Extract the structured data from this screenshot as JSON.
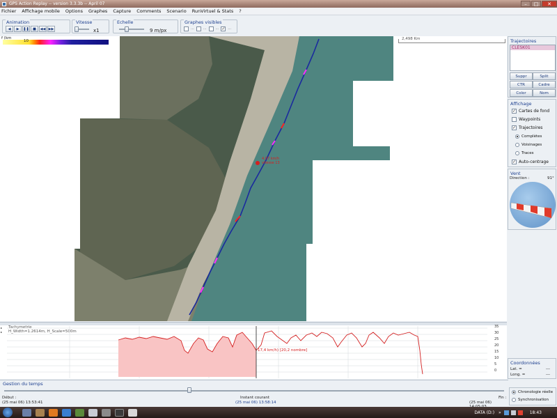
{
  "window": {
    "title": "GPS Action Replay -- version 3.3.3b -- April 07"
  },
  "menu": [
    "Fichier",
    "Affichage mobile",
    "Options",
    "Graphes",
    "Capture",
    "Comments",
    "Scenario",
    "RunVirtuel & Stats",
    "?"
  ],
  "toolbar": {
    "animation_label": "Animation",
    "vitesse_label": "Vitesse",
    "vitesse_value": "x1",
    "echelle_label": "Echelle",
    "echelle_value": "9 m/px",
    "graphes_label": "Graphes visibles",
    "graph_checks": [
      {
        "label": "...",
        "checked": false
      },
      {
        "label": "...",
        "checked": false
      },
      {
        "label": "...",
        "checked": false
      },
      {
        "label": "...",
        "checked": true
      }
    ]
  },
  "map": {
    "speed_scale_unit": "f (km",
    "speed_scale_mark": "10",
    "distance_label": "2,498 Km",
    "track_label_1": "4,07 km/h",
    "track_label_2": "vitesse 13"
  },
  "trajectoires": {
    "title": "Trajectoires",
    "selected_item": "CLESK01",
    "buttons": [
      "Suppr",
      "Split",
      "CTR",
      "Cadre",
      "Color",
      "Nom"
    ]
  },
  "affichage": {
    "title": "Affichage",
    "cartes": {
      "label": "Cartes de fond",
      "checked": true
    },
    "waypoints": {
      "label": "Waypoints",
      "checked": false
    },
    "trajectoires": {
      "label": "Trajectoires",
      "checked": true
    },
    "radio_completes": {
      "label": "Complètes",
      "selected": true
    },
    "radio_voisinages": {
      "label": "Voisinages",
      "selected": false
    },
    "radio_traces": {
      "label": "Traces",
      "selected": false
    },
    "autocentrage": {
      "label": "Auto-centrage",
      "checked": true
    }
  },
  "vent": {
    "title": "Vent",
    "direction_label": "Direction :",
    "direction_value": "91°"
  },
  "graph": {
    "title": "Tachymetrie",
    "subtitle": "H_Width=1.2614m, H_Scale=500m",
    "cursor_label": "17,4 km/h) [20,2 nombre]",
    "yticks": [
      "35",
      "30",
      "25",
      "20",
      "15",
      "10",
      "5",
      "0"
    ]
  },
  "coordonnees": {
    "title": "Coordonnées",
    "lat_label": "Lat. =",
    "lat_value": "---",
    "long_label": "Long. =",
    "long_value": "---"
  },
  "time": {
    "title": "Gestion du temps",
    "debut_label": "Début :",
    "debut_value": "(25 mai 06) 13:53:41",
    "instant_label": "Instant courant",
    "instant_value": "(25 mai 06) 13:58:14",
    "fin_label": "Fin :",
    "fin_value": "(25 mai 06) 14:05:03",
    "progress": 0.37
  },
  "chrono": {
    "reelle": "Chronologie réelle",
    "sync": "Synchronisation"
  },
  "taskbar": {
    "lang": "DATA (D:)",
    "clock": "18:43"
  },
  "colors": {
    "accent": "#1d3f8f",
    "graph_line": "#d42020",
    "graph_fill": "#f9c4c4",
    "track": "#1a2a9e"
  }
}
